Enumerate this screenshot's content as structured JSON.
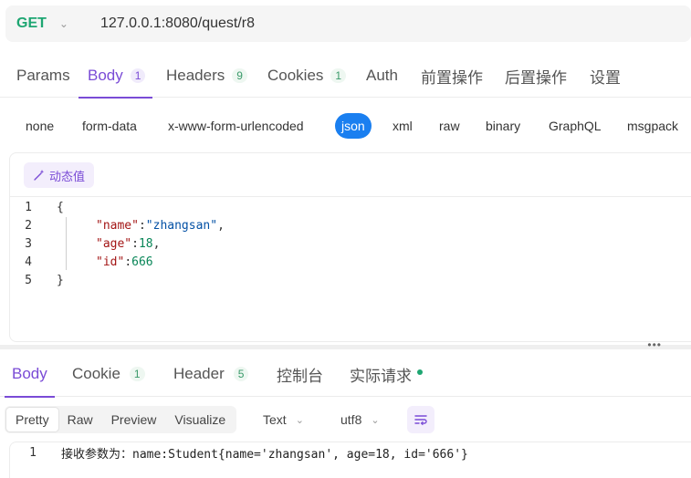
{
  "request": {
    "method": "GET",
    "url": "127.0.0.1:8080/quest/r8"
  },
  "request_tabs": [
    {
      "label": "Params",
      "count": null
    },
    {
      "label": "Body",
      "count": "1"
    },
    {
      "label": "Headers",
      "count": "9"
    },
    {
      "label": "Cookies",
      "count": "1"
    },
    {
      "label": "Auth",
      "count": null
    },
    {
      "label": "前置操作",
      "count": null
    },
    {
      "label": "后置操作",
      "count": null
    },
    {
      "label": "设置",
      "count": null
    }
  ],
  "active_request_tab": "Body",
  "body_types": [
    "none",
    "form-data",
    "x-www-form-urlencoded",
    "json",
    "xml",
    "raw",
    "binary",
    "GraphQL",
    "msgpack"
  ],
  "active_body_type": "json",
  "dynamic_value_label": "动态值",
  "code_lines": [
    {
      "n": "1",
      "text": "{"
    },
    {
      "n": "2",
      "key": "\"name\"",
      "sep": ":",
      "val": "\"zhangsan\"",
      "tail": ","
    },
    {
      "n": "3",
      "key": "\"age\"",
      "sep": ":",
      "val": "18",
      "tail": ","
    },
    {
      "n": "4",
      "key": "\"id\"",
      "sep": ":",
      "val": "666",
      "tail": ""
    },
    {
      "n": "5",
      "text": "}"
    }
  ],
  "response_tabs": [
    {
      "label": "Body",
      "count": null
    },
    {
      "label": "Cookie",
      "count": "1"
    },
    {
      "label": "Header",
      "count": "5"
    },
    {
      "label": "控制台",
      "count": null
    },
    {
      "label": "实际请求",
      "count": null
    }
  ],
  "active_response_tab": "Body",
  "view_modes": [
    "Pretty",
    "Raw",
    "Preview",
    "Visualize"
  ],
  "active_view_mode": "Pretty",
  "format_select": "Text",
  "encoding_select": "utf8",
  "response_line": {
    "n": "1",
    "text": "接收参数为：name:Student{name='zhangsan', age=18, id='666'}"
  },
  "colors": {
    "accent": "#7a4bd6",
    "method_get": "#1ea672",
    "json_active": "#1a7ff0",
    "status_dot": "#1ea672"
  },
  "icons": [
    "chevron-down-icon",
    "magic-wand-icon",
    "more-dots-icon",
    "wrap-lines-icon",
    "status-dot-icon"
  ]
}
